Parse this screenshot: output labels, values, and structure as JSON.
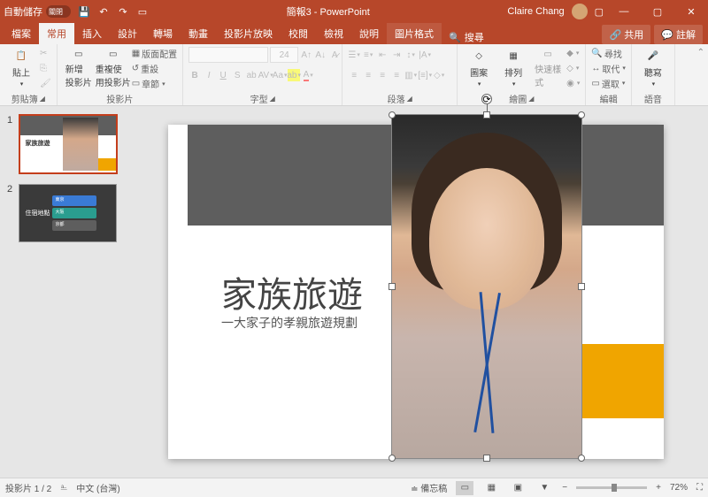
{
  "titlebar": {
    "autosave_label": "自動儲存",
    "autosave_state": "關閉",
    "doc_title": "簡報3 - PowerPoint",
    "user": "Claire Chang"
  },
  "tabs": {
    "file": "檔案",
    "home": "常用",
    "insert": "插入",
    "design": "設計",
    "transitions": "轉場",
    "animations": "動畫",
    "slideshow": "投影片放映",
    "review": "校閱",
    "view": "檢視",
    "help": "說明",
    "picture_format": "圖片格式",
    "search": "搜尋",
    "share": "共用",
    "comments": "註解"
  },
  "ribbon": {
    "clipboard": {
      "label": "剪貼簿",
      "paste": "貼上"
    },
    "slides": {
      "label": "投影片",
      "new": "新增\n投影片",
      "reuse": "重複使\n用投影片",
      "layout": "版面配置",
      "reset": "重設",
      "section": "章節"
    },
    "font": {
      "label": "字型",
      "size": "24"
    },
    "paragraph": {
      "label": "段落"
    },
    "drawing": {
      "label": "繪圖",
      "shapes": "圖案",
      "arrange": "排列",
      "quickstyles": "快速樣\n式"
    },
    "editing": {
      "label": "編輯",
      "find": "尋找",
      "replace": "取代",
      "select": "選取"
    },
    "voice": {
      "label": "語音",
      "dictate": "聽寫"
    }
  },
  "slide": {
    "title": "家族旅遊",
    "subtitle": "一大家子的孝親旅遊規劃"
  },
  "thumb2": {
    "left": "住宿地點",
    "bar1": "東京",
    "bar2": "大阪",
    "bar3": "京都"
  },
  "statusbar": {
    "slide_count": "投影片 1 / 2",
    "language": "中文 (台灣)",
    "notes": "備忘稿",
    "zoom": "72%"
  }
}
